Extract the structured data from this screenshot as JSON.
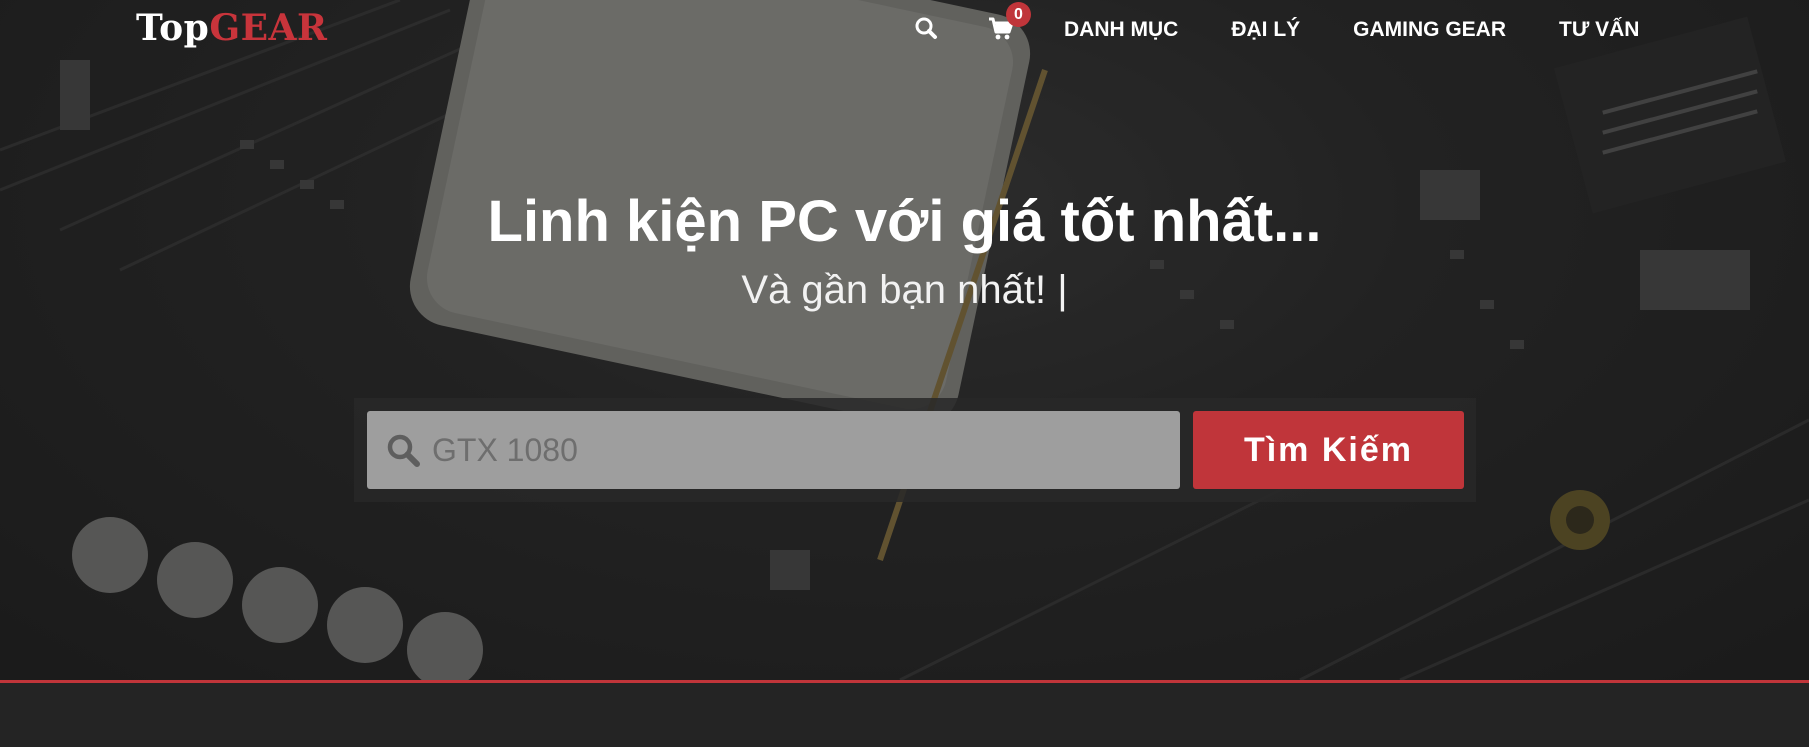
{
  "brand": {
    "logo_top": "Top",
    "logo_gear": "GEAR"
  },
  "nav": {
    "cart_count": "0",
    "links": [
      "DANH MỤC",
      "ĐẠI LÝ",
      "GAMING GEAR",
      "TƯ VẤN"
    ]
  },
  "hero": {
    "headline": "Linh kiện PC với giá tốt nhất...",
    "subline": "Và gần bạn nhất! |",
    "background": "motherboard-cpu-photo"
  },
  "search": {
    "placeholder": "GTX 1080",
    "button_label": "Tìm Kiếm"
  },
  "colors": {
    "accent": "#c0353a",
    "background": "#242424",
    "text": "#ffffff"
  }
}
